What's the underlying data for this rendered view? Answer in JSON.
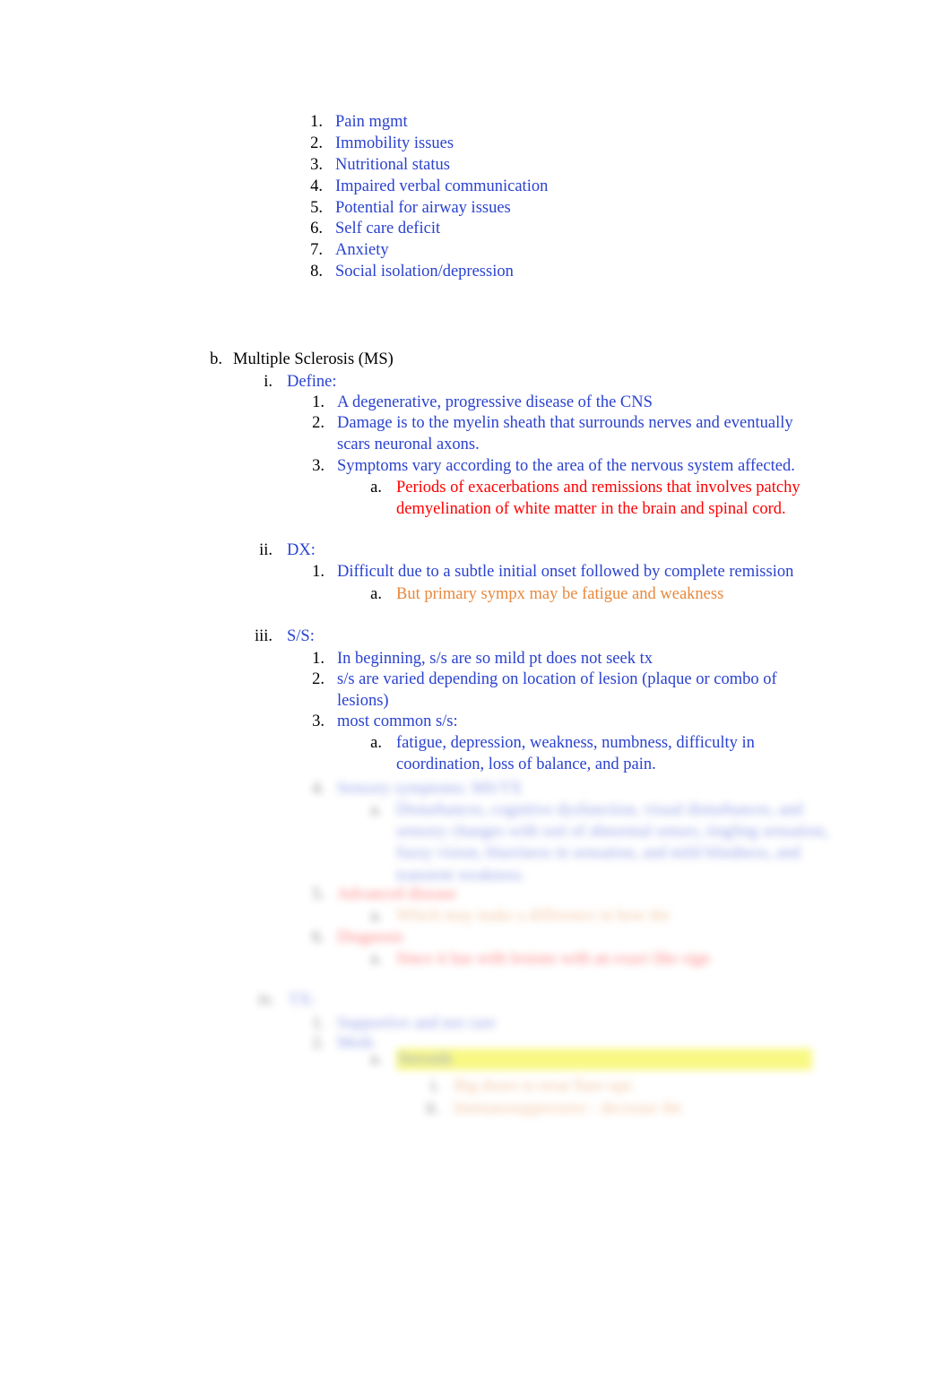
{
  "document": {
    "page_background": "#ffffff",
    "text_colors": {
      "blue": "#2A42CF",
      "black": "#000000",
      "red": "#FF0000",
      "orange": "#E8883C",
      "highlight_yellow": "#F2F20A"
    }
  },
  "top_list": {
    "items": [
      {
        "marker": "1.",
        "text": "Pain mgmt"
      },
      {
        "marker": "2.",
        "text": "Immobility issues"
      },
      {
        "marker": "3.",
        "text": "Nutritional status"
      },
      {
        "marker": "4.",
        "text": "Impaired verbal communication"
      },
      {
        "marker": "5.",
        "text": "Potential for airway issues"
      },
      {
        "marker": "6.",
        "text": "Self care deficit"
      },
      {
        "marker": "7.",
        "text": "Anxiety"
      },
      {
        "marker": "8.",
        "text": "Social isolation/depression"
      }
    ]
  },
  "section_b": {
    "marker": "b.",
    "heading": "Multiple Sclerosis (MS)",
    "define": {
      "marker": "i.",
      "label": "Define:",
      "items": [
        {
          "marker": "1.",
          "text": "A degenerative, progressive disease of the CNS"
        },
        {
          "marker": "2.",
          "text": "Damage is to the myelin sheath that surrounds nerves and eventually scars neuronal axons."
        },
        {
          "marker": "3.",
          "text": "Symptoms vary according to the area of the nervous system affected."
        }
      ],
      "sub_a": {
        "marker": "a.",
        "text": "Periods of exacerbations and remissions that involves patchy demyelination of white matter in the brain and spinal cord."
      }
    },
    "dx": {
      "marker": "ii.",
      "label": "DX:",
      "items": [
        {
          "marker": "1.",
          "text": "Difficult due to a subtle initial onset followed by complete remission"
        }
      ],
      "sub_a": {
        "marker": "a.",
        "text": "But primary sympx may be fatigue and weakness"
      }
    },
    "ss": {
      "marker": "iii.",
      "label": "S/S:",
      "items": [
        {
          "marker": "1.",
          "text": "In beginning, s/s are so mild pt does not seek tx"
        },
        {
          "marker": "2.",
          "text": "s/s are varied depending on location of lesion (plaque or combo of lesions)"
        },
        {
          "marker": "3.",
          "text": "most common s/s:"
        }
      ],
      "sub_a": {
        "marker": "a.",
        "text": "fatigue, depression, weakness, numbness, difficulty in coordination, loss of balance, and pain."
      }
    }
  },
  "obscured": {
    "note": "blurred-illegible-content",
    "lines": [
      {
        "marker": "4.",
        "text": "Sensory symptoms: MS/TX",
        "color": "blue",
        "level": 3
      },
      {
        "marker": "a.",
        "text": "Disturbances, cognitive dysfunction, visual disturbances, and sensory changes with sort of abnormal senses, tingling sensation, fuzzy vision, blurriness in sensation, and mild blindness, and transient weakness.",
        "color": "blue",
        "level": 4
      },
      {
        "marker": "5.",
        "text": "Advanced disease",
        "color": "red",
        "level": 3
      },
      {
        "marker": "a.",
        "text": "Which may make a difference in how the",
        "color": "orange",
        "level": 4
      },
      {
        "marker": "6.",
        "text": "Diagnosis",
        "color": "red",
        "level": 3
      },
      {
        "marker": "a.",
        "text": "Since it has with lesions with an exact like sign",
        "color": "red",
        "level": 4
      },
      {
        "marker": "iv.",
        "text": "TX:",
        "color": "blue",
        "level": 2
      },
      {
        "marker": "1.",
        "text": "Supportive and not cure",
        "color": "blue",
        "level": 3
      },
      {
        "marker": "2.",
        "text": "Meds",
        "color": "blue",
        "level": 3
      },
      {
        "marker": "a.",
        "text": "Steroids",
        "color": "blue",
        "level": 4,
        "highlight": true
      },
      {
        "marker": "i.",
        "text": "Big doses to treat flare-ups",
        "color": "orange",
        "level": 5
      },
      {
        "marker": "ii.",
        "text": "Immunosuppressive - decrease the",
        "color": "orange",
        "level": 5
      }
    ]
  }
}
